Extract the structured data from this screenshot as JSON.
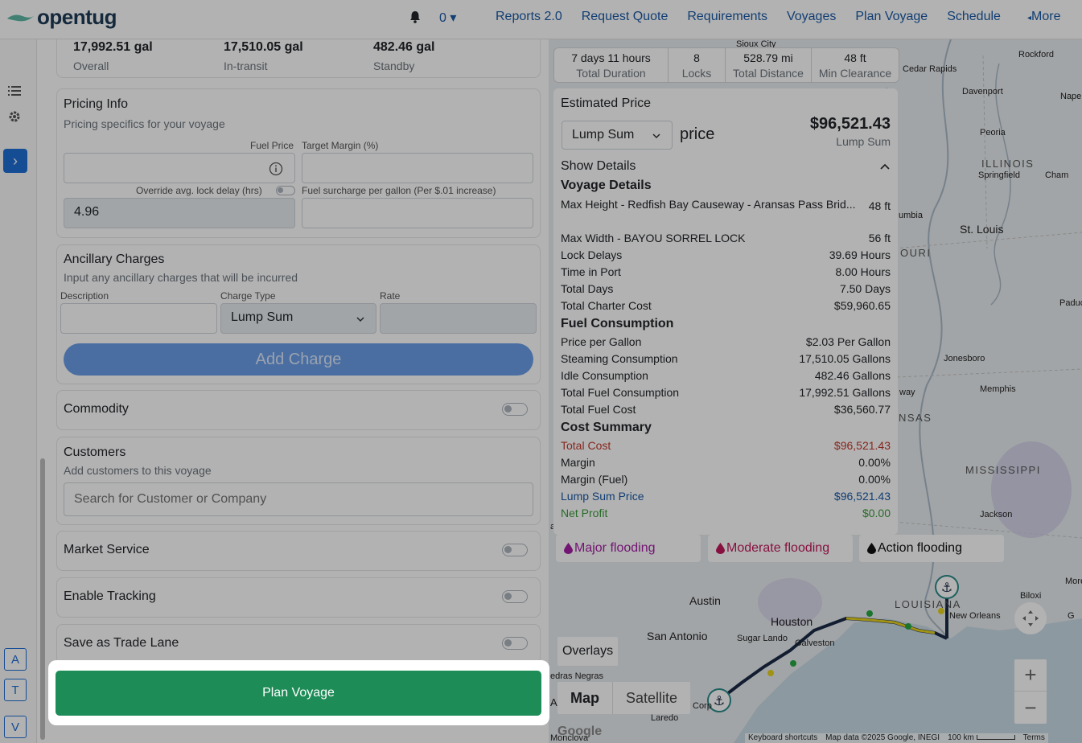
{
  "nav": {
    "brand": "opentug",
    "notification_count": "0",
    "links": [
      "Reports 2.0",
      "Request Quote",
      "Requirements",
      "Voyages",
      "Plan Voyage",
      "Schedule"
    ],
    "more": "More"
  },
  "sidebar": {
    "letters": [
      "A",
      "T",
      "V"
    ]
  },
  "fuel": {
    "overall_value": "17,992.51 gal",
    "overall_label": "Overall",
    "in_transit_value": "17,510.05 gal",
    "in_transit_label": "In-transit",
    "standby_value": "482.46 gal",
    "standby_label": "Standby"
  },
  "pricing": {
    "title": "Pricing Info",
    "subtitle": "Pricing specifics for your voyage",
    "fuel_price_label": "Fuel Price",
    "target_margin_label": "Target Margin (%)",
    "lock_delay_label": "Override avg. lock delay (hrs)",
    "lock_delay_value": "4.96",
    "surcharge_label": "Fuel surcharge per gallon (Per $.01 increase)"
  },
  "ancillary": {
    "title": "Ancillary Charges",
    "subtitle": "Input any ancillary charges that will be incurred",
    "description_label": "Description",
    "charge_type_label": "Charge Type",
    "charge_type_value": "Lump Sum",
    "rate_label": "Rate",
    "add_button": "Add Charge"
  },
  "sections": {
    "commodity": "Commodity",
    "customers_title": "Customers",
    "customers_subtitle": "Add customers to this voyage",
    "customer_search_placeholder": "Search for Customer or Company",
    "market_service": "Market Service",
    "enable_tracking": "Enable Tracking",
    "trade_lane": "Save as Trade Lane"
  },
  "plan_button": "Plan Voyage",
  "summary": [
    {
      "value": "7 days 11 hours",
      "label": "Total Duration"
    },
    {
      "value": "8",
      "label": "Locks"
    },
    {
      "value": "528.79 mi",
      "label": "Total Distance"
    },
    {
      "value": "48 ft",
      "label": "Min Clearance"
    }
  ],
  "estimate": {
    "title": "Estimated Price",
    "select_value": "Lump Sum",
    "price_word": "price",
    "amount": "$96,521.43",
    "amount_sub": "Lump Sum",
    "show_details": "Show Details",
    "voyage_details_title": "Voyage Details",
    "max_height_label": "Max Height - Redfish Bay Causeway - Aransas Pass Brid...",
    "max_height_value": "48 ft",
    "voyage_rows": [
      {
        "label": "Max Width - BAYOU SORREL LOCK",
        "value": "56 ft"
      },
      {
        "label": "Lock Delays",
        "value": "39.69 Hours"
      },
      {
        "label": "Time in Port",
        "value": "8.00 Hours"
      },
      {
        "label": "Total Days",
        "value": "7.50 Days"
      },
      {
        "label": "Total Charter Cost",
        "value": "$59,960.65"
      }
    ],
    "fuel_title": "Fuel Consumption",
    "fuel_rows": [
      {
        "label": "Price per Gallon",
        "value": "$2.03 Per Gallon"
      },
      {
        "label": "Steaming Consumption",
        "value": "17,510.05 Gallons"
      },
      {
        "label": "Idle Consumption",
        "value": "482.46 Gallons"
      },
      {
        "label": "Total Fuel Consumption",
        "value": "17,992.51 Gallons"
      },
      {
        "label": "Total Fuel Cost",
        "value": "$36,560.77"
      }
    ],
    "cost_title": "Cost Summary",
    "cost_rows": [
      {
        "label": "Total Cost",
        "value": "$96,521.43",
        "color": "#c0392b"
      },
      {
        "label": "Margin",
        "value": "0.00%",
        "color": "#212529"
      },
      {
        "label": "Margin (Fuel)",
        "value": "0.00%",
        "color": "#212529"
      },
      {
        "label": "Lump Sum Price",
        "value": "$96,521.43",
        "color": "#1a5aa6"
      },
      {
        "label": "Net Profit",
        "value": "$0.00",
        "color": "#3c9a3c"
      }
    ]
  },
  "floods": [
    {
      "label": "Major flooding",
      "color": "#a51fa5"
    },
    {
      "label": "Moderate flooding",
      "color": "#c2185b"
    },
    {
      "label": "Action flooding",
      "color": "#111111"
    }
  ],
  "map": {
    "overlays": "Overlays",
    "map_type": "Map",
    "satellite": "Satellite",
    "zoom_in": "+",
    "zoom_out": "−",
    "attribution": {
      "shortcuts": "Keyboard shortcuts",
      "data": "Map data ©2025 Google, INEGI",
      "scale": "100 km",
      "terms": "Terms"
    },
    "google": "Google",
    "labels": {
      "sioux_city": "Sioux City",
      "rockford": "Rockford",
      "cedar_rapids": "Cedar Rapids",
      "davenport": "Davenport",
      "naperville": "Nape",
      "peoria": "Peoria",
      "illinois": "ILLINOIS",
      "springfield": "Springfield",
      "champaign": "Cham",
      "columbia": "umbia",
      "st_louis": "St. Louis",
      "missouri": "OURI",
      "paducah": "Paduca",
      "jonesboro": "Jonesboro",
      "memphis": "Memphis",
      "conway": "way",
      "arkansas": "NSAS",
      "mississippi": "MISSISSIPPI",
      "jackson": "Jackson",
      "austin": "Austin",
      "louisiana": "LOUISIANA",
      "biloxi": "Biloxi",
      "new_orleans": "New Orleans",
      "houston": "Houston",
      "san_antonio": "San Antonio",
      "sugar_land": "Sugar Lando",
      "galveston": "Galveston",
      "piedras": "edras Negras",
      "laredo": "Laredo",
      "corpus": "Corp",
      "monclova": "Monclova",
      "anc": "anc",
      "more_right": "More",
      "g_right": "G",
      "ai": "AI"
    }
  }
}
